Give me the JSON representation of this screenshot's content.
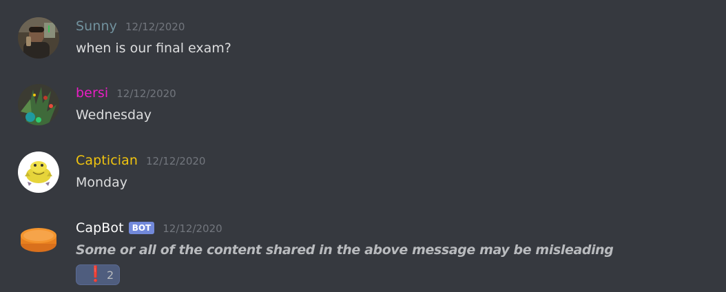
{
  "messages": [
    {
      "username": "Sunny",
      "username_color": "#72929e",
      "timestamp": "12/12/2020",
      "content": "when is our final exam?",
      "avatar": "photo-avatar-person"
    },
    {
      "username": "bersi",
      "username_color": "#e91ec4",
      "timestamp": "12/12/2020",
      "content": "Wednesday",
      "avatar": "photo-avatar-plant"
    },
    {
      "username": "Captician",
      "username_color": "#f1c40f",
      "timestamp": "12/12/2020",
      "content": "Monday",
      "avatar": "cartoon-avatar"
    },
    {
      "username": "CapBot",
      "username_color": "#ffffff",
      "badge": "BOT",
      "timestamp": "12/12/2020",
      "content": "Some or all of the content shared in the above message may be misleading",
      "avatar": "orange-cap-avatar",
      "reaction": {
        "emoji": "❗",
        "count": "2"
      }
    }
  ],
  "colors": {
    "background": "#36393f",
    "timestamp": "#72767d",
    "text": "#dcddde",
    "bot_badge": "#7289da",
    "reaction_bg": "#4f5d7e"
  }
}
